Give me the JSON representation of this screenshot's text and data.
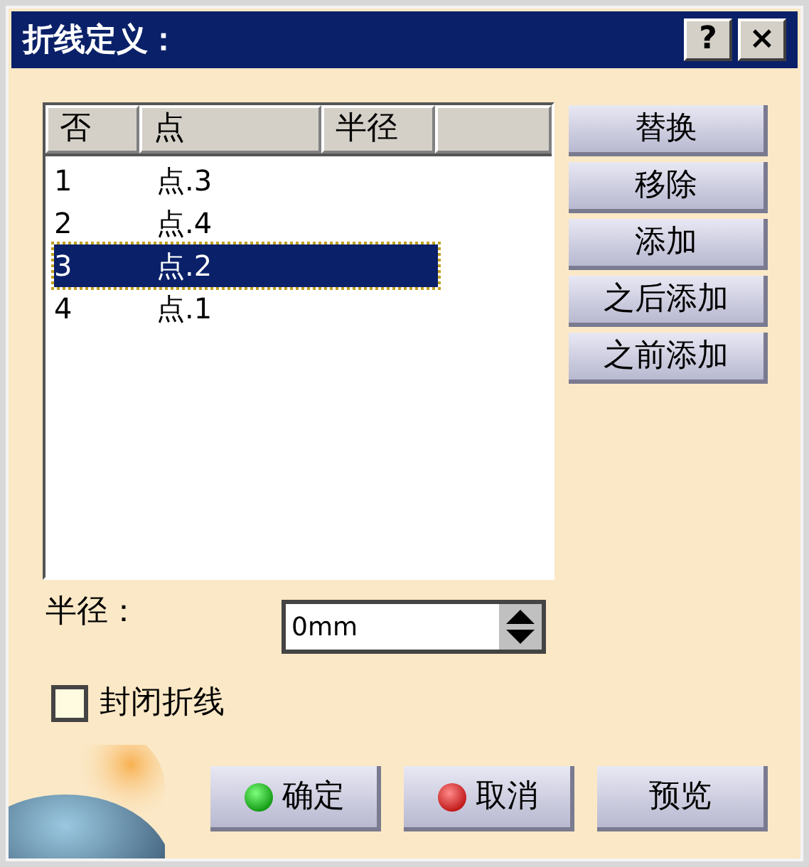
{
  "window": {
    "title": "折线定义：",
    "title_buttons": [
      "?",
      "×"
    ]
  },
  "table": {
    "columns": [
      "否",
      "点",
      "半径"
    ],
    "rows": [
      {
        "cells": [
          "1",
          "点.3"
        ],
        "selected": false
      },
      {
        "cells": [
          "2",
          "点.4"
        ],
        "selected": false
      },
      {
        "cells": [
          "3",
          "点.2"
        ],
        "selected": true
      },
      {
        "cells": [
          "4",
          "点.1"
        ],
        "selected": false
      }
    ]
  },
  "side_buttons": [
    "替换",
    "移除",
    "添加",
    "之后添加",
    "之前添加"
  ],
  "radius": {
    "label": "半径：",
    "value": "0mm"
  },
  "close_polyline": {
    "label": "封闭折线",
    "checked": false
  },
  "footer_buttons": [
    {
      "label": "确定",
      "kind": "ok"
    },
    {
      "label": "取消",
      "kind": "cancel"
    },
    {
      "label": "预览",
      "kind": "plain"
    }
  ]
}
